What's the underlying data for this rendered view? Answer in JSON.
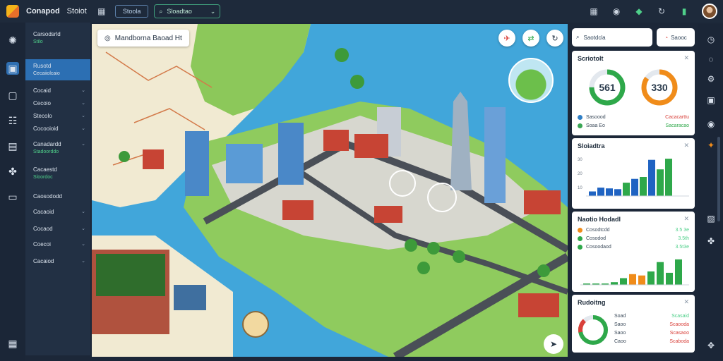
{
  "header": {
    "app_name": "Conapod",
    "menu_label": "Stoiot",
    "filter_button": "Stoola",
    "search_text": "Sloadtao",
    "icons": [
      "grid-icon",
      "filter-icon",
      "compass-icon",
      "tag-icon",
      "sync-icon",
      "battery-icon"
    ]
  },
  "nav": {
    "items": [
      {
        "label": "Carsodsrld",
        "sub": "Stilo"
      },
      {
        "label": "Rusotd",
        "sub": "Cecaiiolcaio"
      },
      {
        "label": "Cocaid"
      },
      {
        "label": "Cecoio"
      },
      {
        "label": "Stecolo"
      },
      {
        "label": "Cocooioid"
      },
      {
        "label": "Canadardd",
        "sub": "Stadoorddo"
      },
      {
        "label": "Cacaestd",
        "sub": "Sloordoc"
      },
      {
        "label": "Caosododd"
      },
      {
        "label": "Cacaoid"
      },
      {
        "label": "Cocaod"
      },
      {
        "label": "Coecoi"
      },
      {
        "label": "Cacaiod"
      }
    ]
  },
  "map": {
    "title": "Mandborna Baoad Ht",
    "buttons": [
      "rocket-icon",
      "share-icon",
      "refresh-icon"
    ],
    "colors": {
      "water": "#41a6da",
      "land": "#f1ead2",
      "park": "#7cc14f"
    }
  },
  "widgets": {
    "search_placeholder": "Saotdcla",
    "save_label": "Saooc",
    "card1": {
      "title": "Scriotolt",
      "gauges": [
        {
          "value": "561",
          "fill": 0.75
        },
        {
          "value": "330",
          "fill": 0.85
        }
      ],
      "legend": [
        {
          "label": "Sasoood",
          "value": "Cacacarttu",
          "color": "#2f7fc6"
        },
        {
          "label": "Soaa Eo",
          "value": "Sacaracao",
          "color": "#3aa655"
        }
      ]
    },
    "card2": {
      "title": "Sloiadtra",
      "y_ticks": [
        "30",
        "20",
        "10"
      ],
      "bars": [
        0.12,
        0.22,
        0.2,
        0.18,
        0.35,
        0.45,
        0.5,
        0.95,
        0.7,
        0.98
      ],
      "bar_colors": [
        "#1f63c2",
        "#1f63c2",
        "#1f63c2",
        "#1f63c2",
        "#2ea84a",
        "#1f63c2",
        "#2ea84a",
        "#1f63c2",
        "#2ea84a",
        "#2ea84a"
      ]
    },
    "card3": {
      "title": "Naotio Hodadl",
      "legend": [
        {
          "label": "Cosodtcdd",
          "value": "3.5 3e",
          "color": "#f08c1a"
        },
        {
          "label": "Cosodod",
          "value": "3.5th",
          "color": "#2ea84a"
        },
        {
          "label": "Cosoodaod",
          "value": "3.5t3e",
          "color": "#2ea84a"
        }
      ],
      "bars": [
        0.05,
        0.05,
        0.05,
        0.1,
        0.25,
        0.4,
        0.35,
        0.5,
        0.85,
        0.45,
        0.95
      ],
      "bar_colors": [
        "#2ea84a",
        "#2ea84a",
        "#2ea84a",
        "#2ea84a",
        "#2ea84a",
        "#f08c1a",
        "#f08c1a",
        "#2ea84a",
        "#2ea84a",
        "#2ea84a",
        "#2ea84a"
      ]
    },
    "card4": {
      "title": "Rudoitng",
      "donut_fill": 0.78,
      "rows": [
        {
          "label": "Soad",
          "value": "Scasaid"
        },
        {
          "label": "Saoo",
          "value": "Scaooda"
        },
        {
          "label": "Saoo",
          "value": "Scasaoo"
        },
        {
          "label": "Caoo",
          "value": "Scaboda"
        }
      ]
    }
  }
}
